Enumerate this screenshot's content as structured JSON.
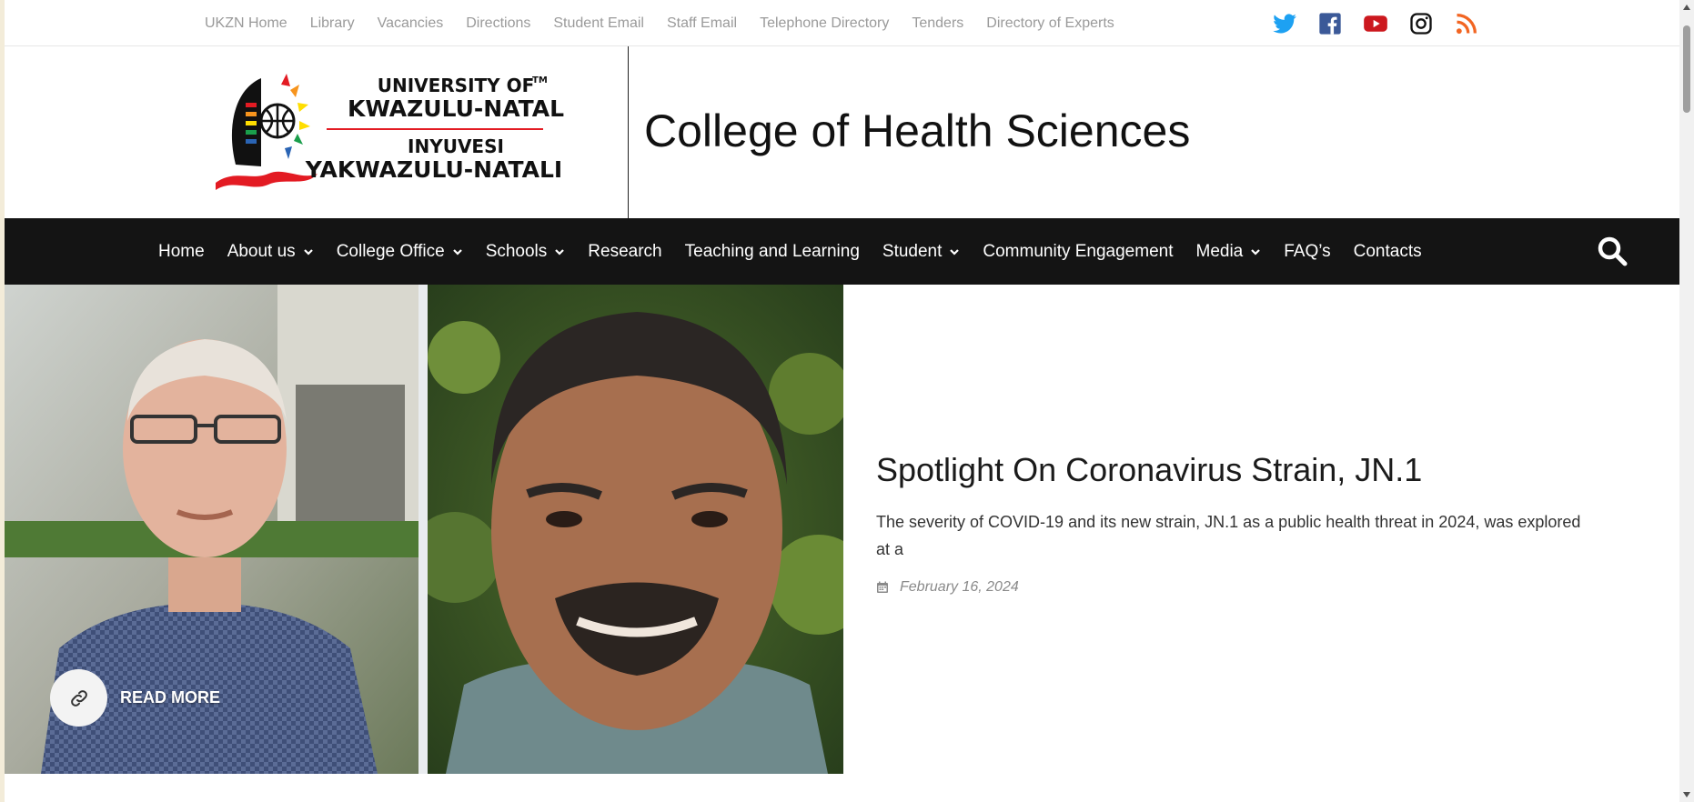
{
  "top_links": [
    "UKZN Home",
    "Library",
    "Vacancies",
    "Directions",
    "Student Email",
    "Staff Email",
    "Telephone Directory",
    "Tenders",
    "Directory of Experts"
  ],
  "social_icons": [
    "twitter-icon",
    "facebook-icon",
    "youtube-icon",
    "instagram-icon",
    "rss-icon"
  ],
  "colors": {
    "twitter": "#1da1f2",
    "facebook": "#3b5998",
    "youtube": "#cc181e",
    "instagram": "#111111",
    "rss": "#f26522",
    "nav_bg": "#141414"
  },
  "logo": {
    "line1": "UNIVERSITY OF",
    "line2": "KWAZULU-NATAL",
    "line3": "INYUVESI",
    "line4": "YAKWAZULU-NATALI",
    "tm": "TM"
  },
  "site_title": "College of Health Sciences",
  "nav": {
    "items": [
      {
        "label": "Home",
        "has_dropdown": false
      },
      {
        "label": "About us",
        "has_dropdown": true
      },
      {
        "label": "College Office",
        "has_dropdown": true
      },
      {
        "label": "Schools",
        "has_dropdown": true
      },
      {
        "label": "Research",
        "has_dropdown": false
      },
      {
        "label": "Teaching and Learning",
        "has_dropdown": false
      },
      {
        "label": "Student",
        "has_dropdown": true
      },
      {
        "label": "Community Engagement",
        "has_dropdown": false
      },
      {
        "label": "Media",
        "has_dropdown": true
      },
      {
        "label": "FAQ’s",
        "has_dropdown": false
      },
      {
        "label": "Contacts",
        "has_dropdown": false
      }
    ],
    "search_icon": "search-icon"
  },
  "hero": {
    "read_more": "READ MORE",
    "title": "Spotlight On Coronavirus Strain, JN.1",
    "excerpt": "The severity of COVID-19 and its new strain, JN.1 as a public health threat in 2024, was explored at a",
    "date": "February 16, 2024"
  }
}
